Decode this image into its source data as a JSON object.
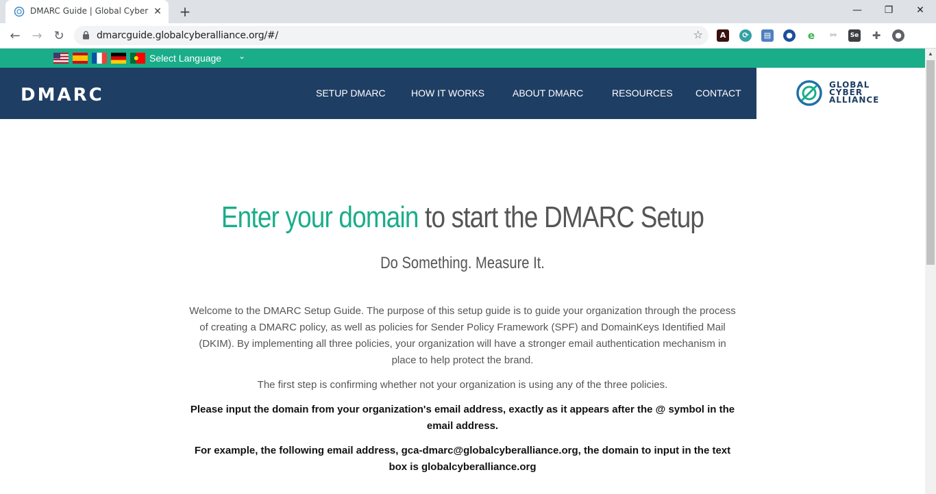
{
  "browser": {
    "tab_title": "DMARC Guide | Global Cyber Alli",
    "tab_close": "✕",
    "new_tab": "+",
    "url": "dmarcguide.globalcyberalliance.org/#/",
    "window_controls": {
      "minimize": "—",
      "restore": "❐",
      "close": "✕"
    },
    "nav": {
      "back": "←",
      "forward": "→",
      "reload": "↻"
    },
    "extensions": [
      "acrobat-icon",
      "extension-teal-icon",
      "extension-blue-icon",
      "extension-circle-icon",
      "extension-e-icon",
      "extension-link-icon",
      "selenium-icon",
      "puzzle-icon",
      "profile-icon"
    ]
  },
  "language_bar": {
    "flags": [
      "us-flag-icon",
      "spain-flag-icon",
      "france-flag-icon",
      "germany-flag-icon",
      "portugal-flag-icon"
    ],
    "select_label": "Select Language"
  },
  "header": {
    "logo": "DMARC",
    "nav": [
      "SETUP DMARC",
      "HOW IT WORKS",
      "ABOUT DMARC",
      "RESOURCES",
      "CONTACT"
    ],
    "partner_logo": [
      "GLOBAL",
      "CYBER",
      "ALLIANCE"
    ]
  },
  "main": {
    "title_highlight": "Enter your domain",
    "title_rest": " to start the DMARC Setup",
    "subtitle": "Do Something. Measure It.",
    "intro": "Welcome to the DMARC Setup Guide. The purpose of this setup guide is to guide your organization through the process of creating a DMARC policy, as well as policies for Sender Policy Framework (SPF) and DomainKeys Identified Mail (DKIM). By implementing all three policies, your organization will have a stronger email authentication mechanism in place to help protect the brand.",
    "first_step": "The first step is confirming whether not your organization is using any of the three policies.",
    "instruction": "Please input the domain from your organization's email address, exactly as it appears after the @ symbol in the email address.",
    "example": "For example, the following email address, gca-dmarc@globalcyberalliance.org, the domain to input in the text box is globalcyberalliance.org"
  },
  "colors": {
    "accent_green": "#1aad8a",
    "header_navy": "#1f3e64"
  }
}
